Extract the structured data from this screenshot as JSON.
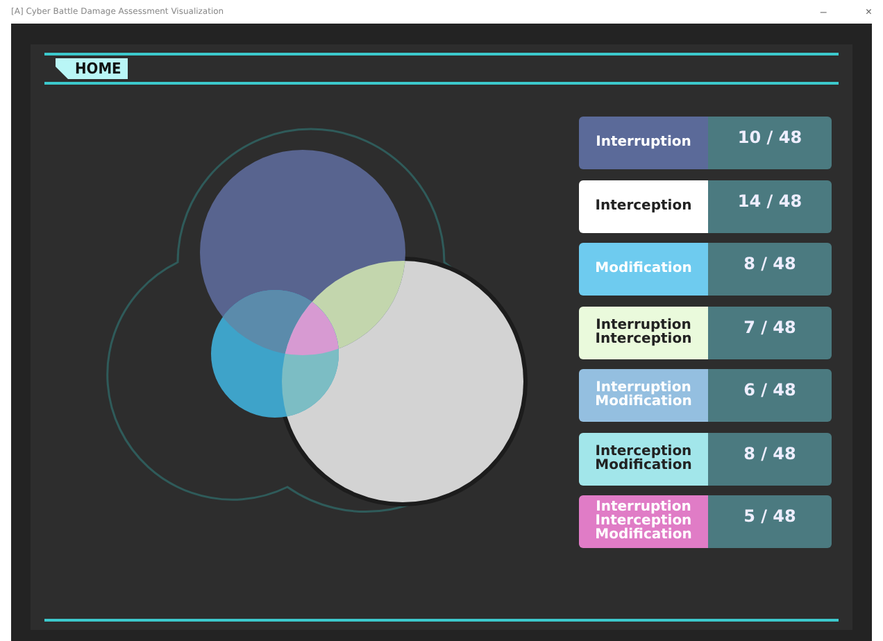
{
  "window": {
    "title": "[A] Cyber Battle Damage Assessment Visualization",
    "controls": [
      "–",
      "×"
    ]
  },
  "nav": {
    "tab": "HOME"
  },
  "legend": [
    {
      "label": "Interruption",
      "value": "10 / 48",
      "color": "#5b6a99",
      "kind": "light-text"
    },
    {
      "label": "Interception",
      "value": "14 / 48",
      "color": "#ffffff",
      "kind": "dark-text"
    },
    {
      "label": "Modification",
      "value": "8 / 48",
      "color": "#6ecbef",
      "kind": "light-text"
    },
    {
      "label": "Interruption\nInterception",
      "value": "7 / 48",
      "color": "#eafadc",
      "kind": "dark-text"
    },
    {
      "label": "Interruption\nModification",
      "value": "6 / 48",
      "color": "#94bfe0",
      "kind": "light-text"
    },
    {
      "label": "Interception\nModification",
      "value": "8 / 48",
      "color": "#a2e6ea",
      "kind": "dark-text"
    },
    {
      "label": "Interruption\nInterception\nModification",
      "value": "5 / 48",
      "color": "#e07cc6",
      "kind": "light-text"
    }
  ]
}
